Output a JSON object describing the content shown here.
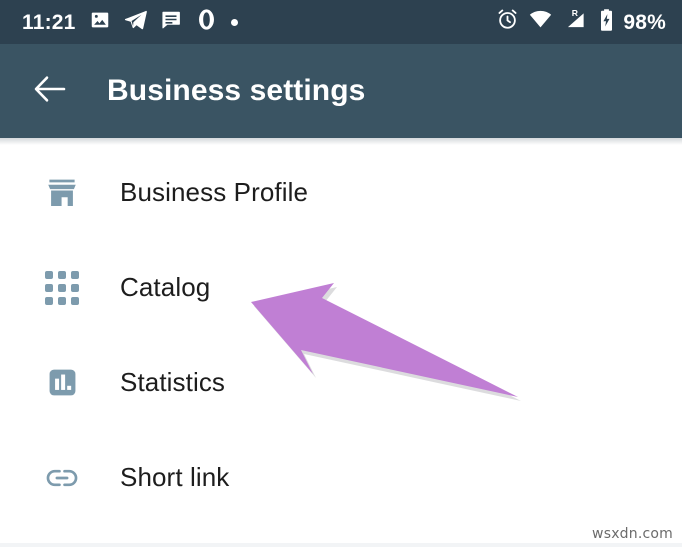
{
  "status_bar": {
    "clock": "11:21",
    "battery_percent": "98%",
    "roaming_label": "R",
    "left_icons": [
      {
        "name": "photo-icon"
      },
      {
        "name": "telegram-icon"
      },
      {
        "name": "message-icon"
      },
      {
        "name": "opera-icon"
      },
      {
        "name": "notification-dot-icon"
      }
    ],
    "right_icons": [
      {
        "name": "alarm-clock-icon"
      },
      {
        "name": "wifi-icon"
      },
      {
        "name": "cellular-signal-icon"
      },
      {
        "name": "battery-charging-icon"
      }
    ]
  },
  "app_bar": {
    "title": "Business settings",
    "back_icon": "arrow-left-icon"
  },
  "list": {
    "items": [
      {
        "label": "Business Profile",
        "icon": "storefront-icon"
      },
      {
        "label": "Catalog",
        "icon": "grid-apps-icon"
      },
      {
        "label": "Statistics",
        "icon": "bar-chart-icon"
      },
      {
        "label": "Short link",
        "icon": "link-icon"
      }
    ]
  },
  "annotation": {
    "arrow_icon": "arrow-pointer-icon",
    "target_label": "Catalog"
  },
  "watermark": {
    "text": "wsxdn.com"
  },
  "colors": {
    "status_bar_bg": "#2d4150",
    "app_bar_bg": "#3a5463",
    "page_bg": "#ffffff",
    "icon_tint": "#7d9bad",
    "label_text": "#1d1d1d",
    "annotation_purple": "#c07fd4"
  }
}
